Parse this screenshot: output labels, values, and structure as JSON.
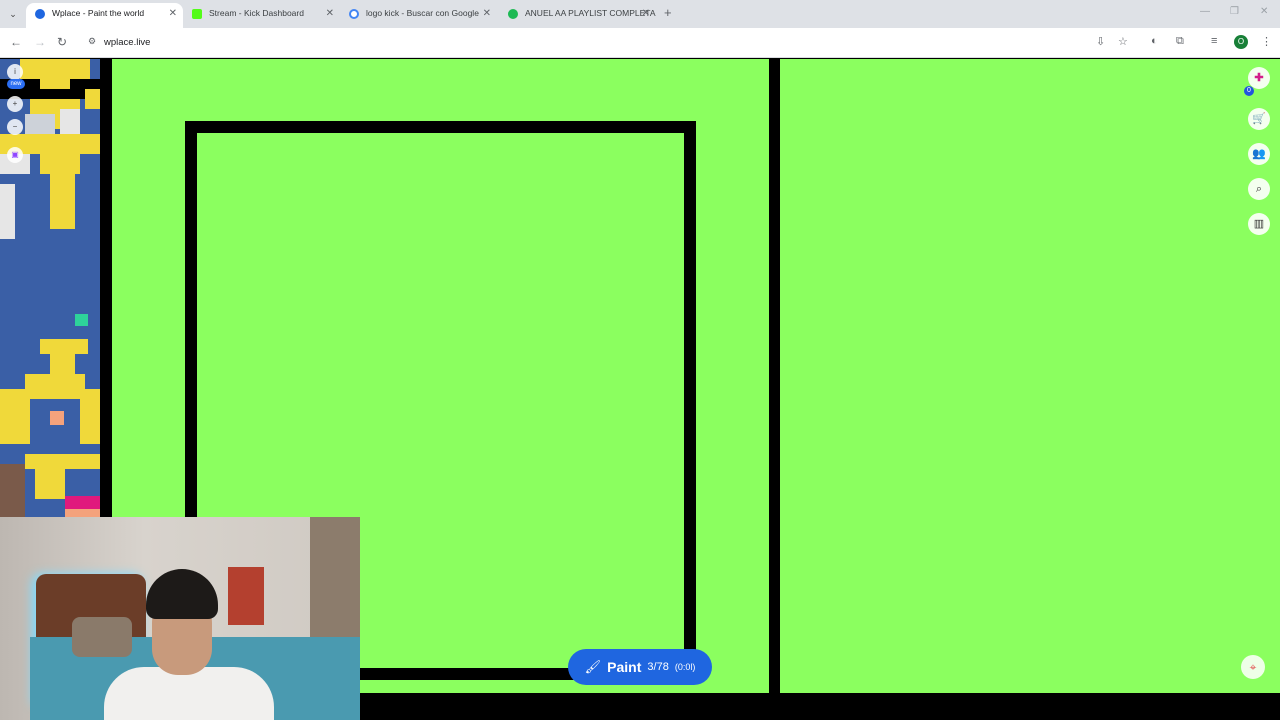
{
  "browser": {
    "tabs": [
      {
        "title": "Wplace - Paint the world",
        "active": true,
        "favicon_color": "#1f66e0"
      },
      {
        "title": "Stream - Kick Dashboard",
        "active": false,
        "favicon_color": "#53fc18"
      },
      {
        "title": "logo kick - Buscar con Google",
        "active": false,
        "favicon_color": "#4285f4"
      },
      {
        "title": "ANUEL AA PLAYLIST COMPLETA",
        "active": false,
        "favicon_color": "#1db954"
      }
    ],
    "url": "wplace.live",
    "profile_initial": "O"
  },
  "left_tools": {
    "new_badge": "new"
  },
  "right_tools": {
    "badge_count": "0"
  },
  "paint_button": {
    "label": "Paint",
    "count": "3/78",
    "timer": "(0:0l)"
  },
  "colors": {
    "canvas_green": "#8bff5f",
    "paint_blue": "#1f66e0",
    "pixel_yellow": "#f0d93a",
    "pixel_blue": "#3a5fa6"
  }
}
